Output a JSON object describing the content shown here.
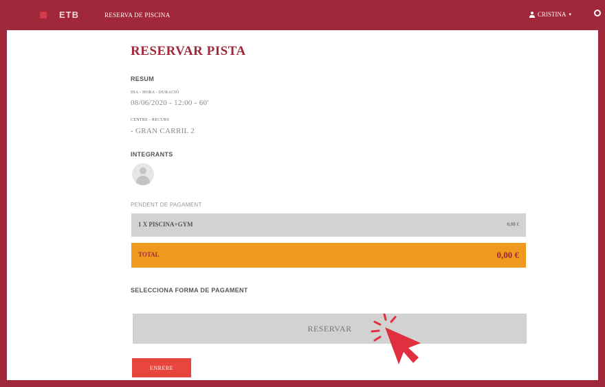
{
  "header": {
    "logo_text": "ETB",
    "app_title": "RESERVA DE PISCINA",
    "user_name": "CRISTINA",
    "user_caret": "▾"
  },
  "page": {
    "title": "RESERVAR PISTA",
    "summary_heading": "RESUM",
    "datetime_label": "DIA - HORA - DURACIÓ",
    "datetime_value": "08/06/2020 - 12:00 - 60'",
    "centre_label": "CENTRE - RECURS",
    "centre_value": "- GRAN CARRIL 2",
    "members_heading": "INTEGRANTS",
    "pending_label": "PENDENT DE PAGAMENT",
    "line_item": {
      "name": "1 X PISCINA+GYM",
      "price": "0,00 €"
    },
    "total": {
      "label": "TOTAL",
      "price": "0,00 €"
    },
    "payment_heading": "SELECCIONA FORMA DE PAGAMENT",
    "reserve_label": "RESERVAR",
    "back_label": "ENRERE"
  },
  "colors": {
    "brand": "#a0283a",
    "total_bg": "#ef9a1f",
    "back_button": "#e8453c",
    "neutral_bar": "#d2d2d2"
  },
  "icons": [
    "user-icon",
    "globe-icon",
    "avatar-placeholder-icon",
    "click-pointer-icon"
  ]
}
